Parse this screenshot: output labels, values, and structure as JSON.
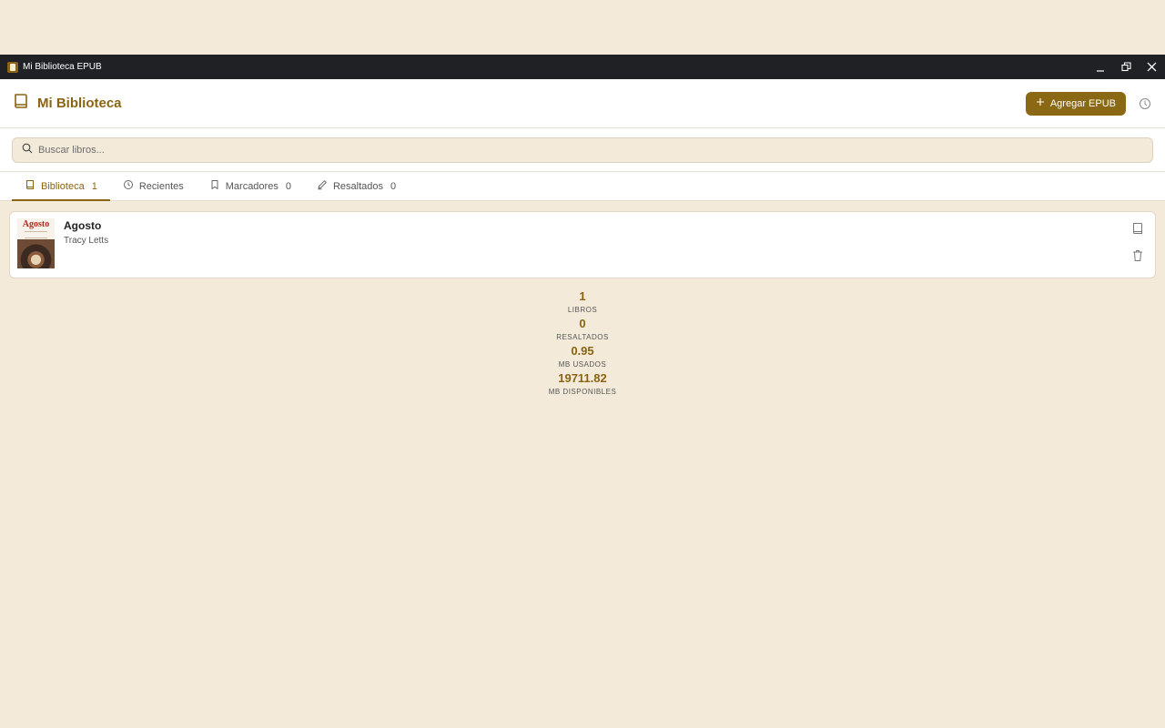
{
  "window": {
    "title": "Mi Biblioteca EPUB",
    "controls": [
      "minimize",
      "restore",
      "close"
    ]
  },
  "header": {
    "title": "Mi Biblioteca",
    "add_button_label": "Agregar EPUB",
    "accent_color": "#8a6412"
  },
  "search": {
    "placeholder": "Buscar libros..."
  },
  "tabs": [
    {
      "label": "Biblioteca",
      "count": "1",
      "icon": "book-icon",
      "active": true
    },
    {
      "label": "Recientes",
      "count": "",
      "icon": "clock-icon",
      "active": false
    },
    {
      "label": "Marcadores",
      "count": "0",
      "icon": "bookmark-icon",
      "active": false
    },
    {
      "label": "Resaltados",
      "count": "0",
      "icon": "pencil-icon",
      "active": false
    }
  ],
  "books": [
    {
      "title": "Agosto",
      "author": "Tracy Letts",
      "cover_title": "Agosto"
    }
  ],
  "stats": [
    {
      "value": "1",
      "label": "LIBROS"
    },
    {
      "value": "0",
      "label": "RESALTADOS"
    },
    {
      "value": "0.95",
      "label": "MB USADOS"
    },
    {
      "value": "19711.82",
      "label": "MB DISPONIBLES"
    }
  ]
}
